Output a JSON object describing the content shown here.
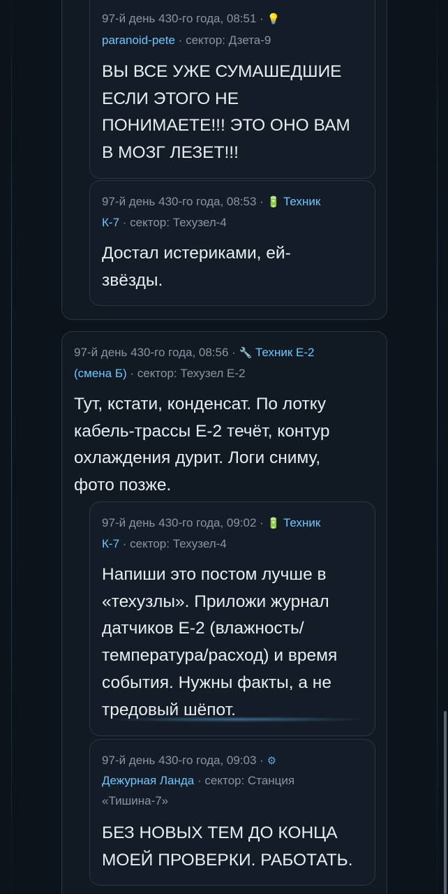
{
  "thread": [
    {
      "id": "post-paranoid",
      "date": "97-й день 430-го года, 08:51",
      "icon": "lightbulb-icon",
      "author": "paranoid-pete",
      "sector": "сектор: Дзета-9",
      "lines": [
        "ВЫ ВСЕ УЖЕ СУМАШЕДШИЕ",
        "ЕСЛИ ЭТОГО НЕ",
        "ПОНИМАЕТЕ!!! ЭТО ОНО ВАМ",
        "В МОЗГ ЛЕЗЕТ!!!"
      ]
    },
    {
      "id": "post-tech-k7-a",
      "date": "97-й день 430-го года, 08:53",
      "icon": "battery-icon",
      "author_line1": "Техник",
      "author_line2": "К-7",
      "sector": "сектор: Техузел-4",
      "lines": [
        "Достал истериками, ей-",
        "звёзды."
      ]
    },
    {
      "id": "post-tech-e2",
      "date": "97-й день 430-го года, 08:56",
      "icon": "wrench-icon",
      "author_line1": "Техник Е-2",
      "author_line2": "(смена Б)",
      "sector": "сектор: Техузел Е-2",
      "lines": [
        "Тут, кстати, конденсат. По лотку",
        "кабель-трассы Е-2 течёт, контур",
        "охлаждения дурит. Логи сниму,",
        "фото позже."
      ]
    },
    {
      "id": "post-tech-k7-b",
      "date": "97-й день 430-го года, 09:02",
      "icon": "battery-icon",
      "author_line1": "Техник",
      "author_line2": "К-7",
      "sector": "сектор: Техузел-4",
      "lines": [
        "Напиши это постом лучше в",
        "«техузлы». Приложи журнал",
        "датчиков Е-2 (влажность/",
        "температура/расход) и время",
        "события. Нужны факты, а не",
        "тредовый шёпот."
      ]
    },
    {
      "id": "post-landa",
      "date": "97-й день 430-го года, 09:03",
      "icon": "gear-icon",
      "author": "Дежурная Ланда",
      "sector_line1": "сектор: Станция",
      "sector_line2": "«Тишина-7»",
      "lines": [
        "БЕЗ НОВЫХ ТЕМ ДО КОНЦА",
        "МОЕЙ ПРОВЕРКИ. РАБОТАТЬ."
      ]
    }
  ],
  "separator": "·",
  "colors": {
    "background": "#0d131b",
    "author_link": "#6ec6ff",
    "meta_text": "#8a95a3",
    "body_text": "#e9edf2",
    "border": "#2c3644"
  }
}
